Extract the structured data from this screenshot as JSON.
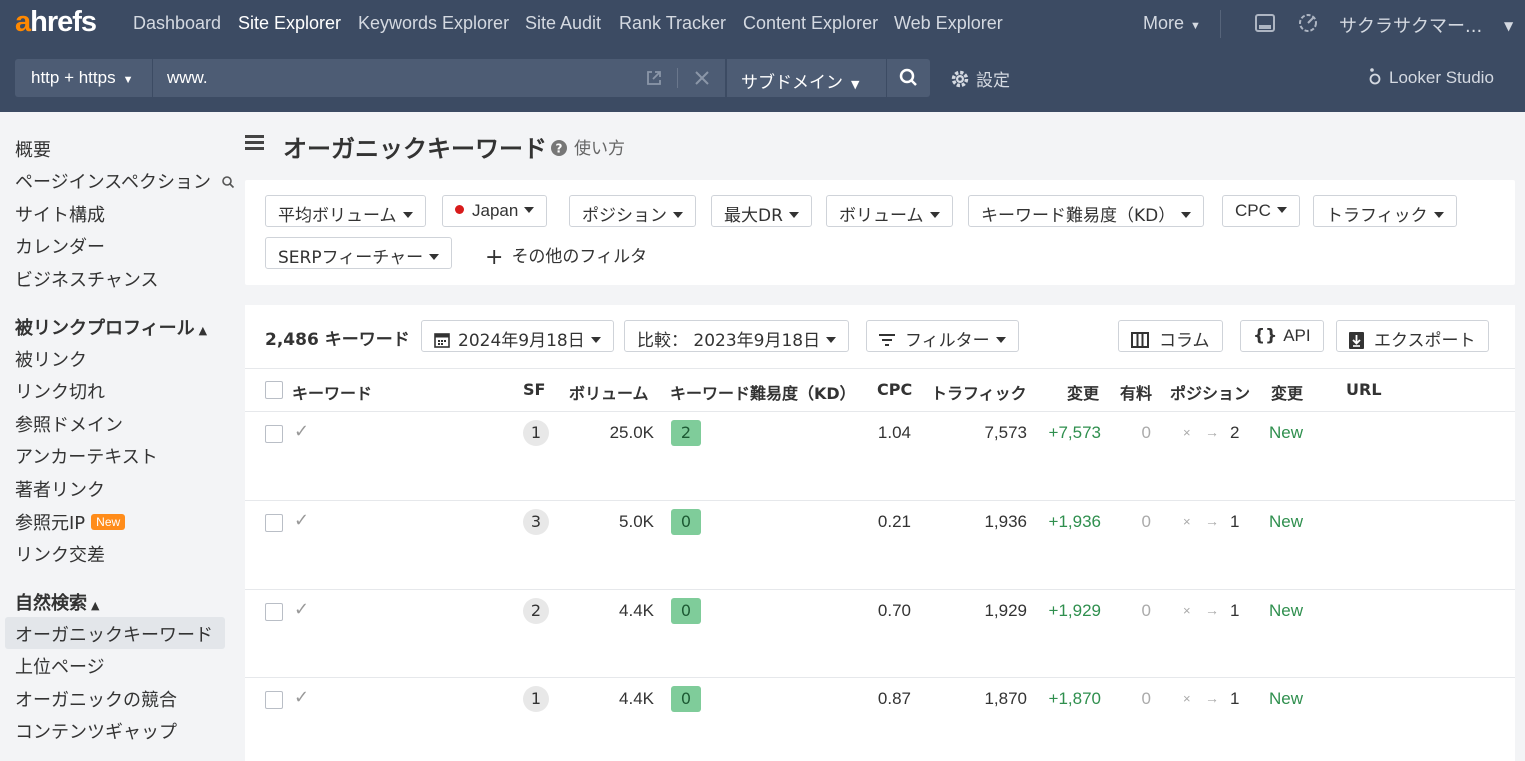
{
  "nav": {
    "logo_a": "a",
    "logo_rest": "hrefs",
    "items": [
      "Dashboard",
      "Site Explorer",
      "Keywords Explorer",
      "Site Audit",
      "Rank Tracker",
      "Content Explorer",
      "Web Explorer"
    ],
    "active": "Site Explorer",
    "more": "More",
    "account": "サクラサクマー..."
  },
  "search": {
    "protocol": "http + https",
    "url_value": "www.",
    "mode": "サブドメイン",
    "settings": "設定",
    "looker": "Looker Studio"
  },
  "sidebar": {
    "group1": [
      "概要",
      "ページインスペクション",
      "サイト構成",
      "カレンダー",
      "ビジネスチャンス"
    ],
    "group2_title": "被リンクプロフィール",
    "group2": [
      "被リンク",
      "リンク切れ",
      "参照ドメイン",
      "アンカーテキスト",
      "著者リンク",
      "参照元IP",
      "リンク交差"
    ],
    "new_badge": "New",
    "group3_title": "自然検索",
    "group3": [
      "オーガニックキーワード",
      "上位ページ",
      "オーガニックの競合",
      "コンテンツギャップ"
    ]
  },
  "page": {
    "title": "オーガニックキーワード",
    "howto": "使い方"
  },
  "filters": {
    "row1": [
      "平均ボリューム",
      "Japan",
      "ポジション",
      "最大DR",
      "ボリューム",
      "キーワード難易度（KD）",
      "CPC",
      "トラフィック"
    ],
    "row2": [
      "SERPフィーチャー"
    ],
    "more": "その他のフィルタ"
  },
  "toolbar": {
    "count": "2,486 キーワード",
    "date": "2024年9月18日",
    "compare": "比較： 2023年9月18日",
    "filter": "フィルター",
    "columns": "コラム",
    "api": "API",
    "export": "エクスポート"
  },
  "table": {
    "headers": [
      "キーワード",
      "SF",
      "ボリューム",
      "キーワード難易度（KD）",
      "CPC",
      "トラフィック",
      "変更",
      "有料",
      "ポジション",
      "変更",
      "URL"
    ],
    "rows": [
      {
        "sf": "1",
        "volume": "25.0K",
        "kd": "2",
        "cpc": "1.04",
        "traffic": "7,573",
        "change": "+7,573",
        "paid": "0",
        "from": "×",
        "pos": "2",
        "pos_change": "New"
      },
      {
        "sf": "3",
        "volume": "5.0K",
        "kd": "0",
        "cpc": "0.21",
        "traffic": "1,936",
        "change": "+1,936",
        "paid": "0",
        "from": "×",
        "pos": "1",
        "pos_change": "New"
      },
      {
        "sf": "2",
        "volume": "4.4K",
        "kd": "0",
        "cpc": "0.70",
        "traffic": "1,929",
        "change": "+1,929",
        "paid": "0",
        "from": "×",
        "pos": "1",
        "pos_change": "New"
      },
      {
        "sf": "1",
        "volume": "4.4K",
        "kd": "0",
        "cpc": "0.87",
        "traffic": "1,870",
        "change": "+1,870",
        "paid": "0",
        "from": "×",
        "pos": "1",
        "pos_change": "New"
      }
    ]
  },
  "colors": {
    "header_bg": "#3c4b63",
    "accent_orange": "#ff8800",
    "kd_green": "#7fcc9a",
    "positive_green": "#2f8f4e"
  }
}
